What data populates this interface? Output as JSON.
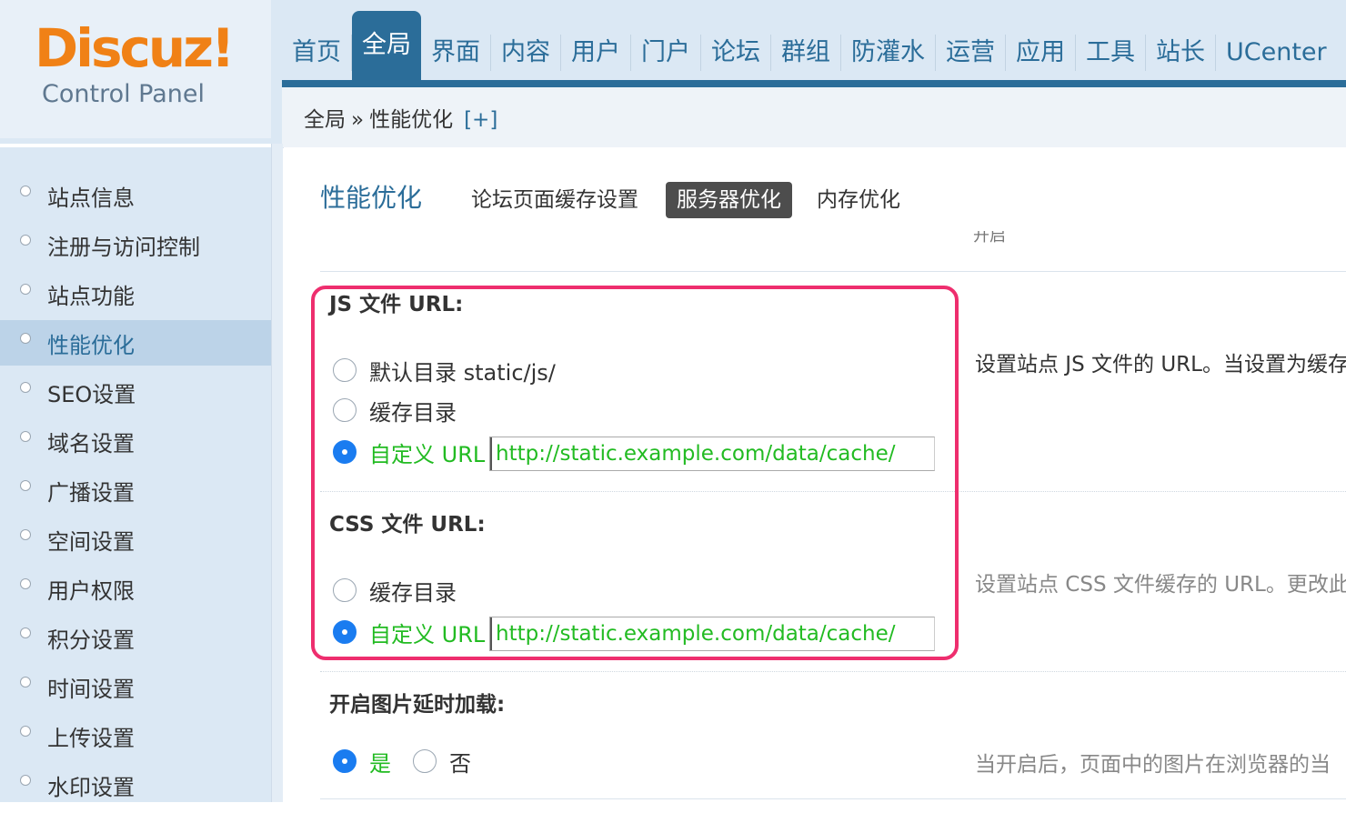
{
  "logo": {
    "word": "Discuz",
    "bang": "!",
    "subtitle": "Control Panel"
  },
  "nav": {
    "items": [
      "首页",
      "全局",
      "界面",
      "内容",
      "用户",
      "门户",
      "论坛",
      "群组",
      "防灌水",
      "运营",
      "应用",
      "工具",
      "站长",
      "UCenter"
    ],
    "active": "全局"
  },
  "breadcrumb": {
    "root": "全局",
    "separator": "»",
    "current": "性能优化",
    "expand": "[+]"
  },
  "sidebar": {
    "items": [
      {
        "label": "站点信息"
      },
      {
        "label": "注册与访问控制"
      },
      {
        "label": "站点功能"
      },
      {
        "label": "性能优化",
        "active": true
      },
      {
        "label": "SEO设置"
      },
      {
        "label": "域名设置"
      },
      {
        "label": "广播设置"
      },
      {
        "label": "空间设置"
      },
      {
        "label": "用户权限"
      },
      {
        "label": "积分设置"
      },
      {
        "label": "时间设置"
      },
      {
        "label": "上传设置"
      },
      {
        "label": "水印设置"
      }
    ]
  },
  "main": {
    "title": "性能优化",
    "tabs": [
      {
        "label": "论坛页面缓存设置"
      },
      {
        "label": "服务器优化",
        "active": true
      },
      {
        "label": "内存优化"
      }
    ],
    "cut_text": "开启",
    "js_setting": {
      "title": "JS 文件 URL:",
      "options": [
        {
          "label": "默认目录 static/js/",
          "selected": false
        },
        {
          "label": "缓存目录",
          "selected": false
        },
        {
          "label": "自定义 URL",
          "selected": true
        }
      ],
      "custom_url": "http://static.example.com/data/cache/",
      "description": "设置站点 JS 文件的 URL。当设置为缓存"
    },
    "css_setting": {
      "title": "CSS 文件 URL:",
      "options": [
        {
          "label": "缓存目录",
          "selected": false
        },
        {
          "label": "自定义 URL",
          "selected": true
        }
      ],
      "custom_url": "http://static.example.com/data/cache/",
      "description": "设置站点 CSS 文件缓存的 URL。更改此"
    },
    "lazyload_setting": {
      "title": "开启图片延时加载:",
      "yes": "是",
      "no": "否",
      "selected": "是",
      "description": "当开启后，页面中的图片在浏览器的当"
    }
  },
  "colors": {
    "brand_orange": "#f08116",
    "nav_blue": "#2b6d99",
    "selected_green": "#22bb22",
    "radio_blue": "#1a7cf0",
    "highlight_pink": "#ee2e6e"
  }
}
